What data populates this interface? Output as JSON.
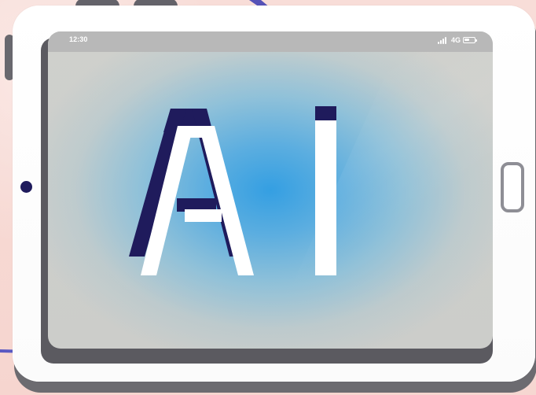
{
  "device": {
    "type": "tablet"
  },
  "status_bar": {
    "time": "12:30",
    "network": "4G",
    "signal_icon": "signal-bars-icon",
    "battery_icon": "battery-icon"
  },
  "screen": {
    "headline": "AI"
  },
  "colors": {
    "background": "#f6d9d3",
    "tablet_body": "#ffffff",
    "tablet_shadow": "#6c6b70",
    "screen_background": "#cccdca",
    "screen_glow": "#2e9de3",
    "ai_fill": "#ffffff",
    "ai_shadow": "#1f1b5c"
  }
}
